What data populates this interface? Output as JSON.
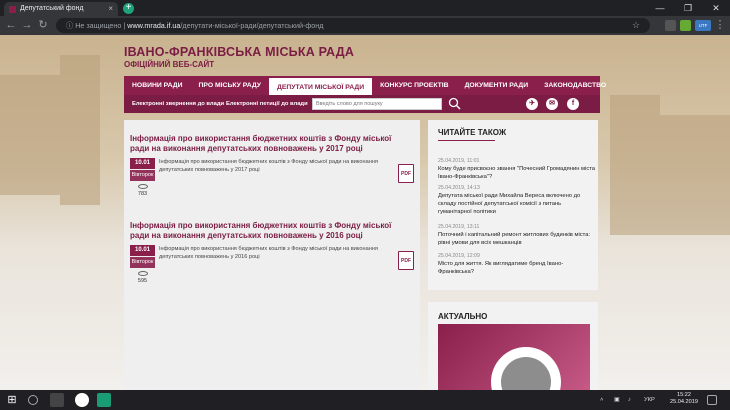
{
  "browser": {
    "tab_title": "Депутатський фонд",
    "tab_close": "×",
    "new_tab": "+",
    "security_label": "Не защищено",
    "url_host": "www.mrada.if.ua",
    "url_path": "/депутати-міської-ради/депутатський-фонд",
    "profile": "UTF"
  },
  "site": {
    "title": "ІВАНО-ФРАНКІВСЬКА МІСЬКА РАДА",
    "subtitle": "ОФІЦІЙНИЙ ВЕБ-САЙТ"
  },
  "menu": [
    {
      "label": "НОВИНИ РАДИ",
      "active": false
    },
    {
      "label": "ПРО МІСЬКУ РАДУ",
      "active": false
    },
    {
      "label": "ДЕПУТАТИ МІСЬКОЇ РАДИ",
      "active": true
    },
    {
      "label": "КОНКУРС ПРОЕКТІВ",
      "active": false
    },
    {
      "label": "ДОКУМЕНТИ РАДИ",
      "active": false
    },
    {
      "label": "ЗАКОНОДАВСТВО",
      "active": false
    }
  ],
  "submenu": {
    "appeals": "Електронні звернення до влади",
    "petitions": "Електронні петиції до влади",
    "search_placeholder": "Введіть слово для пошуку"
  },
  "articles": [
    {
      "title": "Інформація про використання бюджетних коштів з Фонду міської ради на виконання депутатських повноважень у 2017 році",
      "date": "10.01",
      "weekday": "Вівторок",
      "views": "783",
      "desc": "Інформація про використання бюджетних коштів з Фонду міської ради на виконання депутатських повноважень у 2017 році",
      "pdf": "PDF"
    },
    {
      "title": "Інформація про використання бюджетних коштів з Фонду міської ради на виконання депутатських повноважень у 2016 році",
      "date": "10.01",
      "weekday": "Вівторок",
      "views": "595",
      "desc": "Інформація про використання бюджетних коштів з Фонду міської ради на виконання депутатських повноважень у 2016 році",
      "pdf": "PDF"
    }
  ],
  "read_also": {
    "heading": "ЧИТАЙТЕ ТАКОЖ",
    "items": [
      {
        "time": "25.04.2019, 11:01",
        "title": "Кому буде присвоєно звання \"Почесний Громадянин міста Івано-Франківська\"?"
      },
      {
        "time": "25.04.2019, 14:13",
        "title": "Депутата міської ради Михайла Вереса включено до складу постійної депутатської комісії з питань гуманітарної політики"
      },
      {
        "time": "25.04.2019, 13:11",
        "title": "Поточний і капітальний ремонт житлових будинків міста: рівні умови для всіх мешканців"
      },
      {
        "time": "25.04.2019, 12:09",
        "title": "Місто для життя. Як виглядатиме бренд Івано-Франківська?"
      }
    ]
  },
  "actual": {
    "heading": "АКТУАЛЬНО"
  },
  "taskbar": {
    "lang": "УКР",
    "time": "15:22",
    "date": "25.04.2019"
  },
  "colors": {
    "brand": "#8a1f4b",
    "brand_dark": "#7b1c44"
  }
}
